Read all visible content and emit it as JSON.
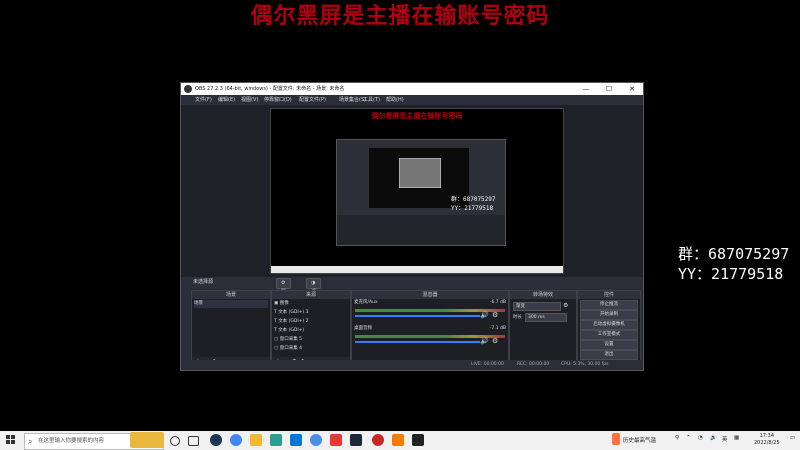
{
  "banner": "偶尔黑屏是主播在输账号密码",
  "side_info": {
    "qun": "群：687075297",
    "yy": "YY：21779518"
  },
  "obs": {
    "title": "OBS 27.2.3 (64-bit, windows) - 配置文件: 未命名 - 场景: 未命名",
    "window_buttons": [
      "—",
      "☐",
      "✕"
    ],
    "menu": [
      "文件(F)",
      "编辑(E)",
      "视图(V)",
      "停靠窗口(D)",
      "配置文件(P)",
      "场景集合(S)",
      "工具(T)",
      "帮助(H)"
    ],
    "canvas_banner": "偶尔黑屏是主播在输账号密码",
    "canvas_side": {
      "qun": "群：687075297",
      "yy": "YY：21779518"
    },
    "scene_status": "未选择源",
    "toolbar": {
      "properties": "属性",
      "filters": "滤镜"
    },
    "docks": {
      "scenes": {
        "title": "场景",
        "items": [
          "场景"
        ]
      },
      "sources": {
        "title": "来源",
        "items": [
          "图像",
          "文本 (GDI+) 3",
          "文本 (GDI+) 2",
          "文本 (GDI+)",
          "窗口采集 5",
          "窗口采集 4"
        ]
      },
      "mixer": {
        "title": "混音器",
        "channels": [
          {
            "name": "麦克风/Aux",
            "db": "-6.7 dB"
          },
          {
            "name": "桌面音频",
            "db": "-7.1 dB"
          }
        ]
      },
      "transitions": {
        "title": "转场特效",
        "selected": "渐变",
        "duration_label": "时长",
        "duration_value": "300 ms"
      },
      "controls": {
        "title": "控件",
        "buttons": [
          "停止推流",
          "开始录制",
          "启动虚拟摄像机",
          "工作室模式",
          "设置",
          "退出"
        ]
      }
    },
    "statusbar": {
      "live": "LIVE: 00:00:00",
      "rec": "REC: 00:00:00",
      "cpu": "CPU: 5.3%, 30.00 fps"
    }
  },
  "taskbar": {
    "search_placeholder": "在这里输入你要搜索的内容",
    "weather": "历史最高气温",
    "time": "17:34",
    "date": "2022/8/25"
  }
}
